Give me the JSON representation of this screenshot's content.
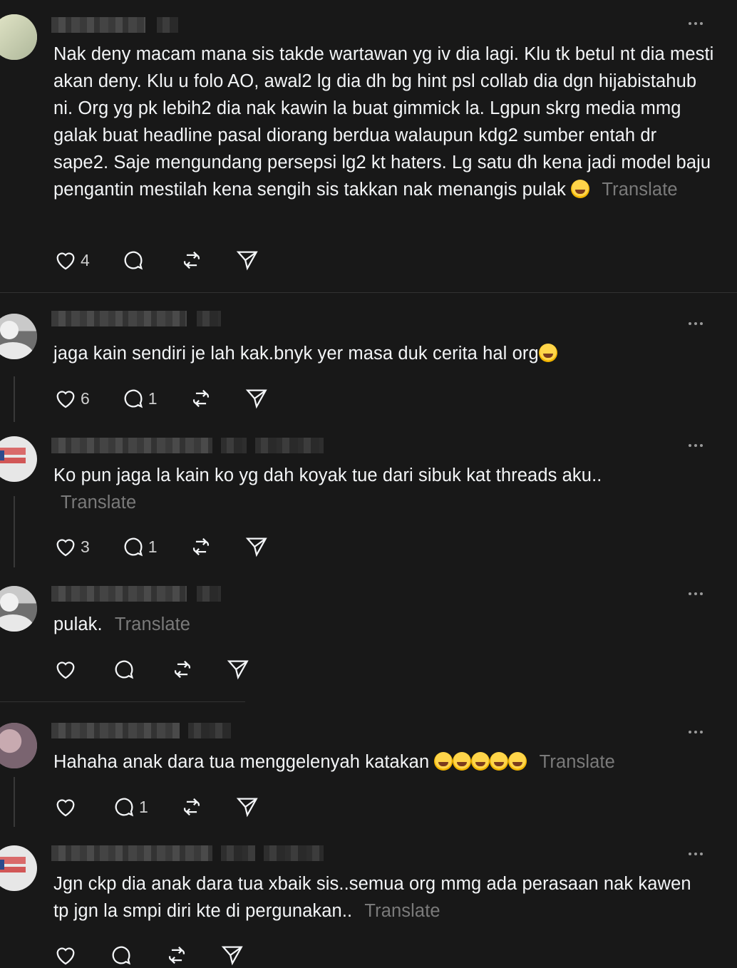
{
  "posts": [
    {
      "avatar_icon": "profile-avatar",
      "text": "Nak deny macam mana sis takde wartawan yg iv dia lagi. Klu tk betul nt dia mesti akan deny. Klu u folo AO, awal2 lg dia dh bg hint psl collab dia dgn hijabistahub ni. Org yg pk lebih2 dia nak kawin la buat gimmick la. Lgpun skrg media mmg galak buat headline pasal diorang berdua walaupun kdg2 sumber entah dr sape2. Saje mengundang persepsi lg2 kt haters. Lg satu dh kena jadi model baju pengantin mestilah kena sengih sis takkan nak menangis pulak",
      "emoji": "😅",
      "translate": "Translate",
      "likes": "4",
      "replies": ""
    },
    {
      "text": "jaga kain sendiri je lah kak.bnyk yer masa duk cerita hal org",
      "emoji": "😅",
      "translate": "",
      "likes": "6",
      "replies": "1"
    },
    {
      "text": "Ko pun jaga la kain ko yg dah koyak tue dari sibuk kat threads aku..",
      "translate": "Translate",
      "likes": "3",
      "replies": "1"
    },
    {
      "text": "pulak.",
      "translate": "Translate",
      "likes": "",
      "replies": ""
    },
    {
      "text": "Hahaha anak dara tua menggelenyah katakan",
      "emoji": "😂😂😂😂😂",
      "translate": "Translate",
      "likes": "",
      "replies": "1"
    },
    {
      "text": "Jgn ckp dia anak dara tua xbaik sis..semua org mmg ada perasaan nak kawen tp jgn la smpi diri kte di pergunakan..",
      "translate": "Translate",
      "likes": "",
      "replies": ""
    }
  ],
  "icons": {
    "like": "heart-icon",
    "reply": "comment-icon",
    "repost": "repost-icon",
    "share": "send-icon",
    "more": "more-options-icon"
  },
  "colors": {
    "background": "#181818",
    "text": "#f3f5f7",
    "muted": "#7a7a7a"
  }
}
